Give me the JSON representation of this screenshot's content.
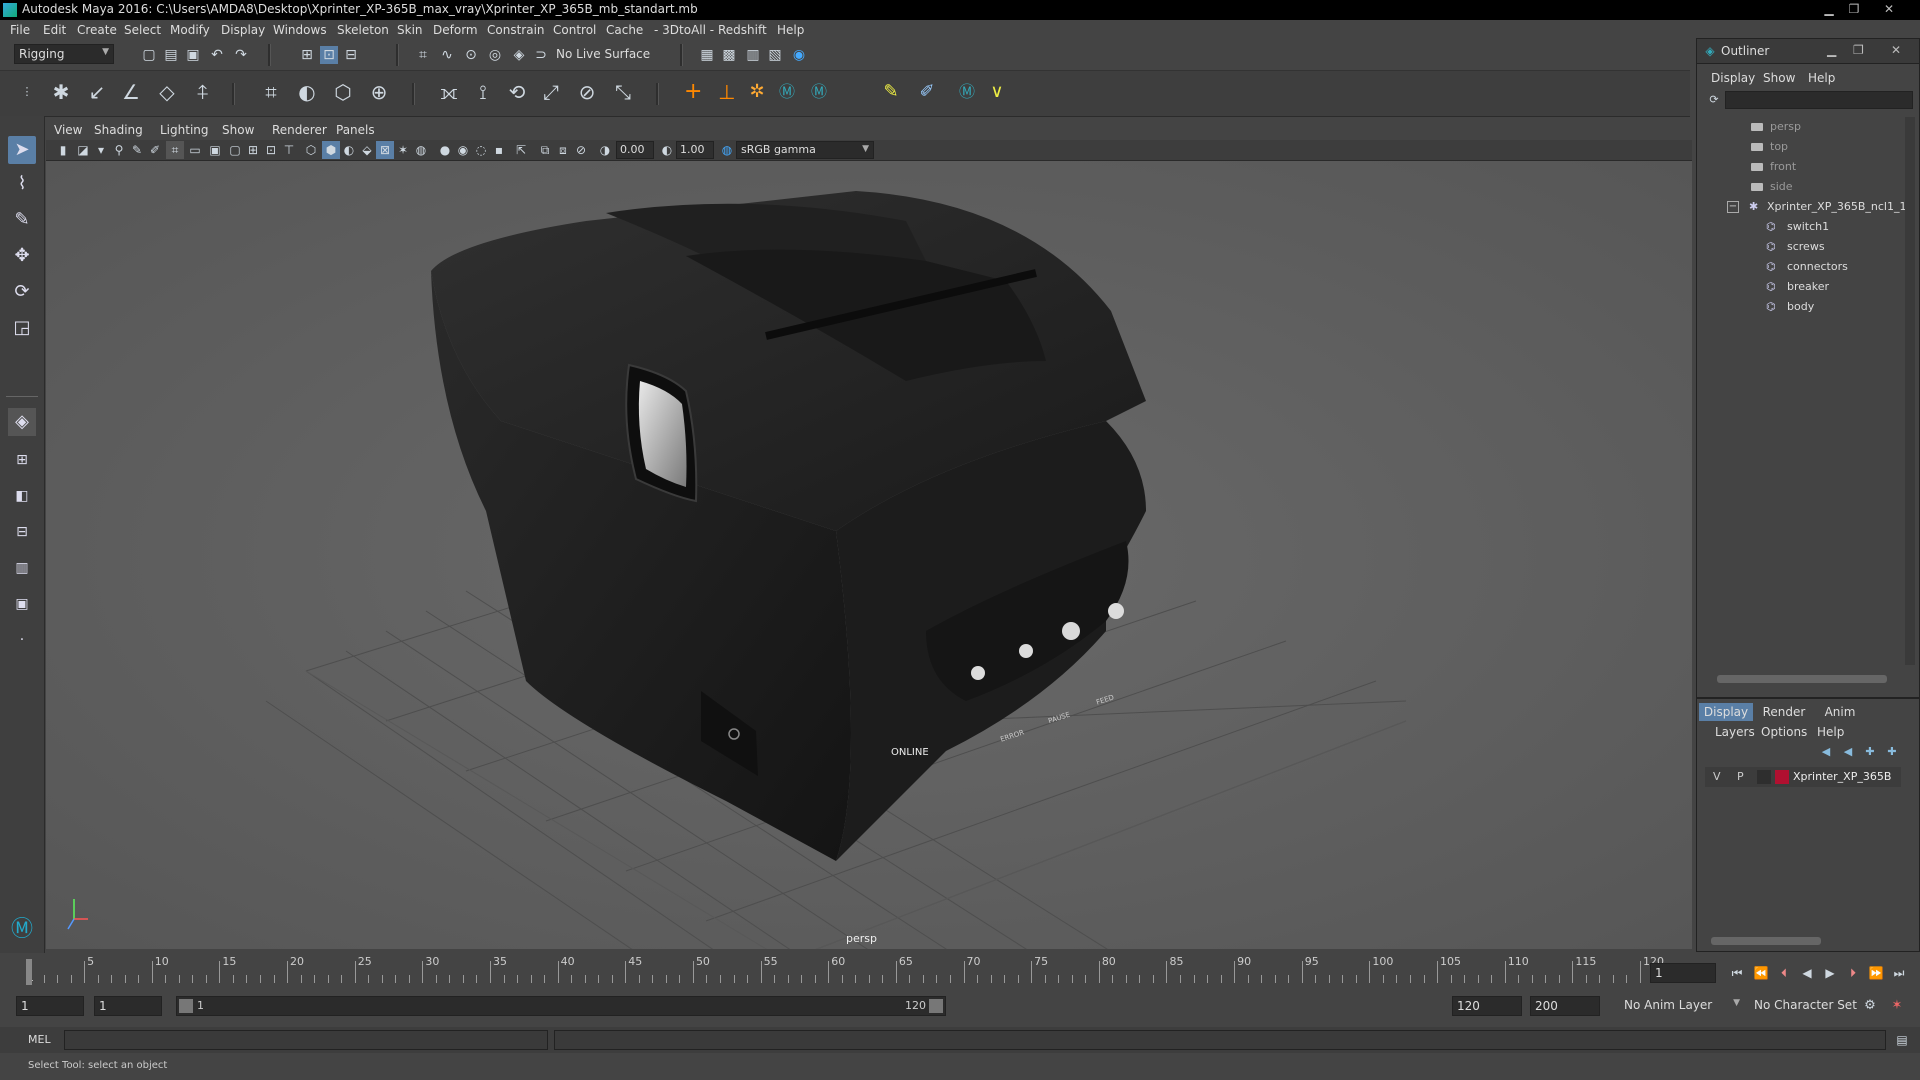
{
  "app": {
    "title": "Autodesk Maya 2016: C:\\Users\\AMDA8\\Desktop\\Xprinter_XP-365B_max_vray\\Xprinter_XP_365B_mb_standart.mb"
  },
  "menu": [
    "File",
    "Edit",
    "Create",
    "Select",
    "Modify",
    "Display",
    "Windows",
    "Skeleton",
    "Skin",
    "Deform",
    "Constrain",
    "Control",
    "Cache",
    "- 3DtoAll -",
    "Redshift",
    "Help"
  ],
  "status": {
    "mode": "Rigging",
    "live_surface": "No Live Surface"
  },
  "viewport": {
    "menu": [
      "View",
      "Shading",
      "Lighting",
      "Show",
      "Renderer",
      "Panels"
    ],
    "exposure": "0.00",
    "gamma": "1.00",
    "colorspace": "sRGB gamma",
    "camera_label": "persp",
    "printer_buttons": [
      "ONLINE",
      "ERROR",
      "PAUSE",
      "FEED"
    ]
  },
  "outliner": {
    "title": "Outliner",
    "menu": [
      "Display",
      "Show",
      "Help"
    ],
    "cameras": [
      "persp",
      "top",
      "front",
      "side"
    ],
    "root": "Xprinter_XP_365B_ncl1_1",
    "children": [
      "switch1",
      "screws",
      "connectors",
      "breaker",
      "body"
    ]
  },
  "layers": {
    "tabs": [
      "Display",
      "Render",
      "Anim"
    ],
    "menu": [
      "Layers",
      "Options",
      "Help"
    ],
    "v": "V",
    "p": "P",
    "layer_name": "Xprinter_XP_365B",
    "layer_color": "#b01030"
  },
  "timeline": {
    "ticks": [
      "5",
      "10",
      "15",
      "20",
      "25",
      "30",
      "35",
      "40",
      "45",
      "50",
      "55",
      "60",
      "65",
      "70",
      "75",
      "80",
      "85",
      "90",
      "95",
      "100",
      "105",
      "110",
      "115",
      "120"
    ],
    "start_label": "1",
    "current_frame": "1"
  },
  "range": {
    "start": "1",
    "playback_start": "1",
    "slider_start": "1",
    "slider_end": "120",
    "playback_end": "120",
    "end": "200",
    "anim_layer": "No Anim Layer",
    "char_set": "No Character Set"
  },
  "cmd": {
    "label": "MEL"
  },
  "help": {
    "text": "Select Tool: select an object"
  },
  "colors": {
    "accent": "#5a7fa6"
  }
}
